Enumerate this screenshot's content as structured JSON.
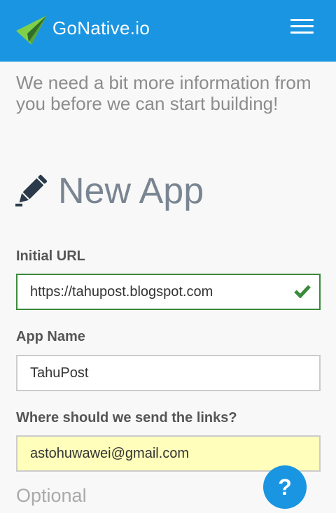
{
  "header": {
    "brand": "GoNative.io",
    "logo_icon": "paper-plane-icon",
    "menu_icon": "hamburger-menu-icon"
  },
  "intro": "We need a bit more information from you before we can start building!",
  "form": {
    "title": "New App",
    "title_icon": "pencil-icon",
    "url_label": "Initial URL",
    "url_value": "https://tahupost.blogspot.com",
    "url_status_icon": "checkmark-icon",
    "name_label": "App Name",
    "name_value": "TahuPost",
    "email_label": "Where should we send the links?",
    "email_value": "astohuwawei@gmail.com",
    "optional_label": "Optional"
  },
  "help_button": "?",
  "colors": {
    "header_bg": "#1a95e1",
    "valid_border": "#3c8a3c",
    "highlight_bg": "#ffffbb"
  }
}
